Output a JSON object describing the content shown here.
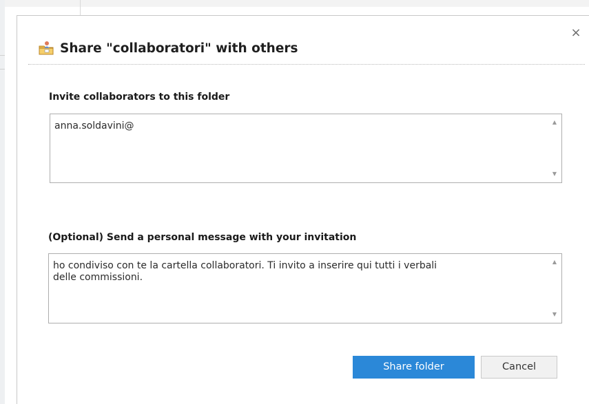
{
  "dialog": {
    "title": "Share \"collaboratori\" with others",
    "close_glyph": "×",
    "title_icon": "share-folder-icon"
  },
  "invite": {
    "label": "Invite collaborators to this folder",
    "value": "anna.soldavini@"
  },
  "message": {
    "label": "(Optional) Send a personal message with your invitation",
    "value": "ho condiviso con te la cartella collaboratori. Ti invito a inserire qui tutti i verbali\ndelle commissioni."
  },
  "buttons": {
    "share_label": "Share folder",
    "cancel_label": "Cancel"
  },
  "colors": {
    "accent": "#2b88d8",
    "border": "#adadad"
  }
}
